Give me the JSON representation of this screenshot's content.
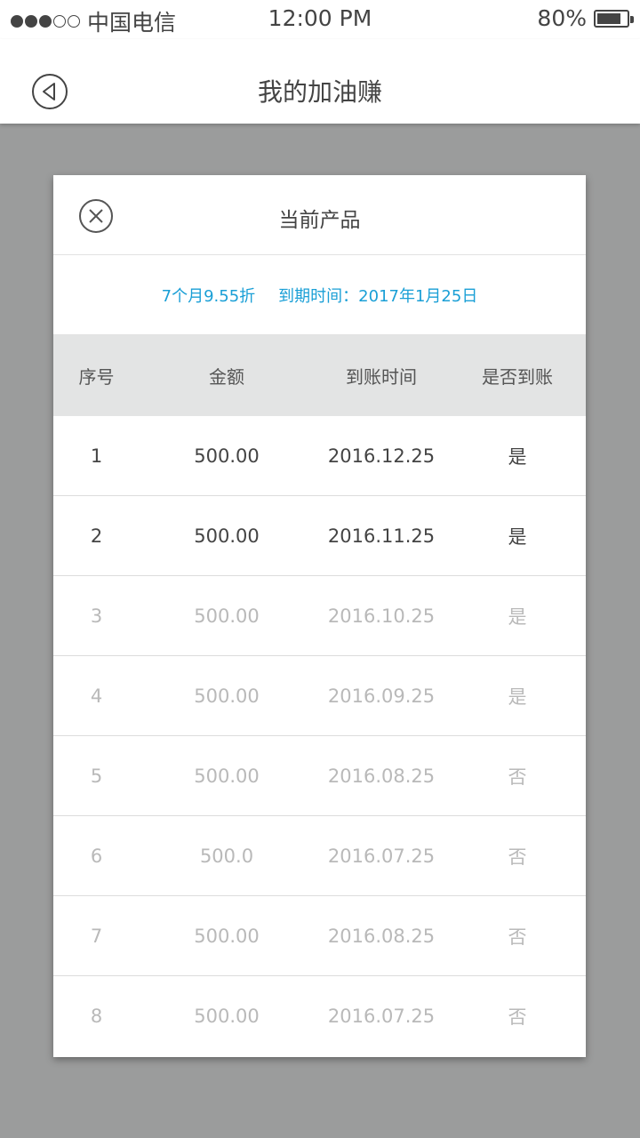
{
  "status_bar": {
    "carrier": "中国电信",
    "time": "12:00 PM",
    "battery": "80%",
    "signal_bars": 3,
    "signal_total": 5
  },
  "nav": {
    "back_icon": "back-circle-icon",
    "title": "我的加油赚"
  },
  "modal": {
    "close_icon": "close-circle-icon",
    "title": "当前产品",
    "product_term": "7个月9.55折",
    "expiry": "到期时间：2017年1月25日",
    "columns": [
      "序号",
      "金额",
      "到账时间",
      "是否到账"
    ],
    "rows": [
      {
        "no": "1",
        "amount": "500.00",
        "date": "2016.12.25",
        "paid": "是"
      },
      {
        "no": "2",
        "amount": "500.00",
        "date": "2016.11.25",
        "paid": "是"
      },
      {
        "no": "3",
        "amount": "500.00",
        "date": "2016.10.25",
        "paid": "是"
      },
      {
        "no": "4",
        "amount": "500.00",
        "date": "2016.09.25",
        "paid": "是"
      },
      {
        "no": "5",
        "amount": "500.00",
        "date": "2016.08.25",
        "paid": "否"
      },
      {
        "no": "6",
        "amount": "500.0",
        "date": "2016.07.25",
        "paid": "否"
      },
      {
        "no": "7",
        "amount": "500.00",
        "date": "2016.08.25",
        "paid": "否"
      },
      {
        "no": "8",
        "amount": "500.00",
        "date": "2016.07.25",
        "paid": "否"
      }
    ]
  },
  "colors": {
    "accent": "#1a9fd6",
    "overlay": "#9b9c9c",
    "text_active": "#444444",
    "text_dim": "#b9b9b9"
  }
}
